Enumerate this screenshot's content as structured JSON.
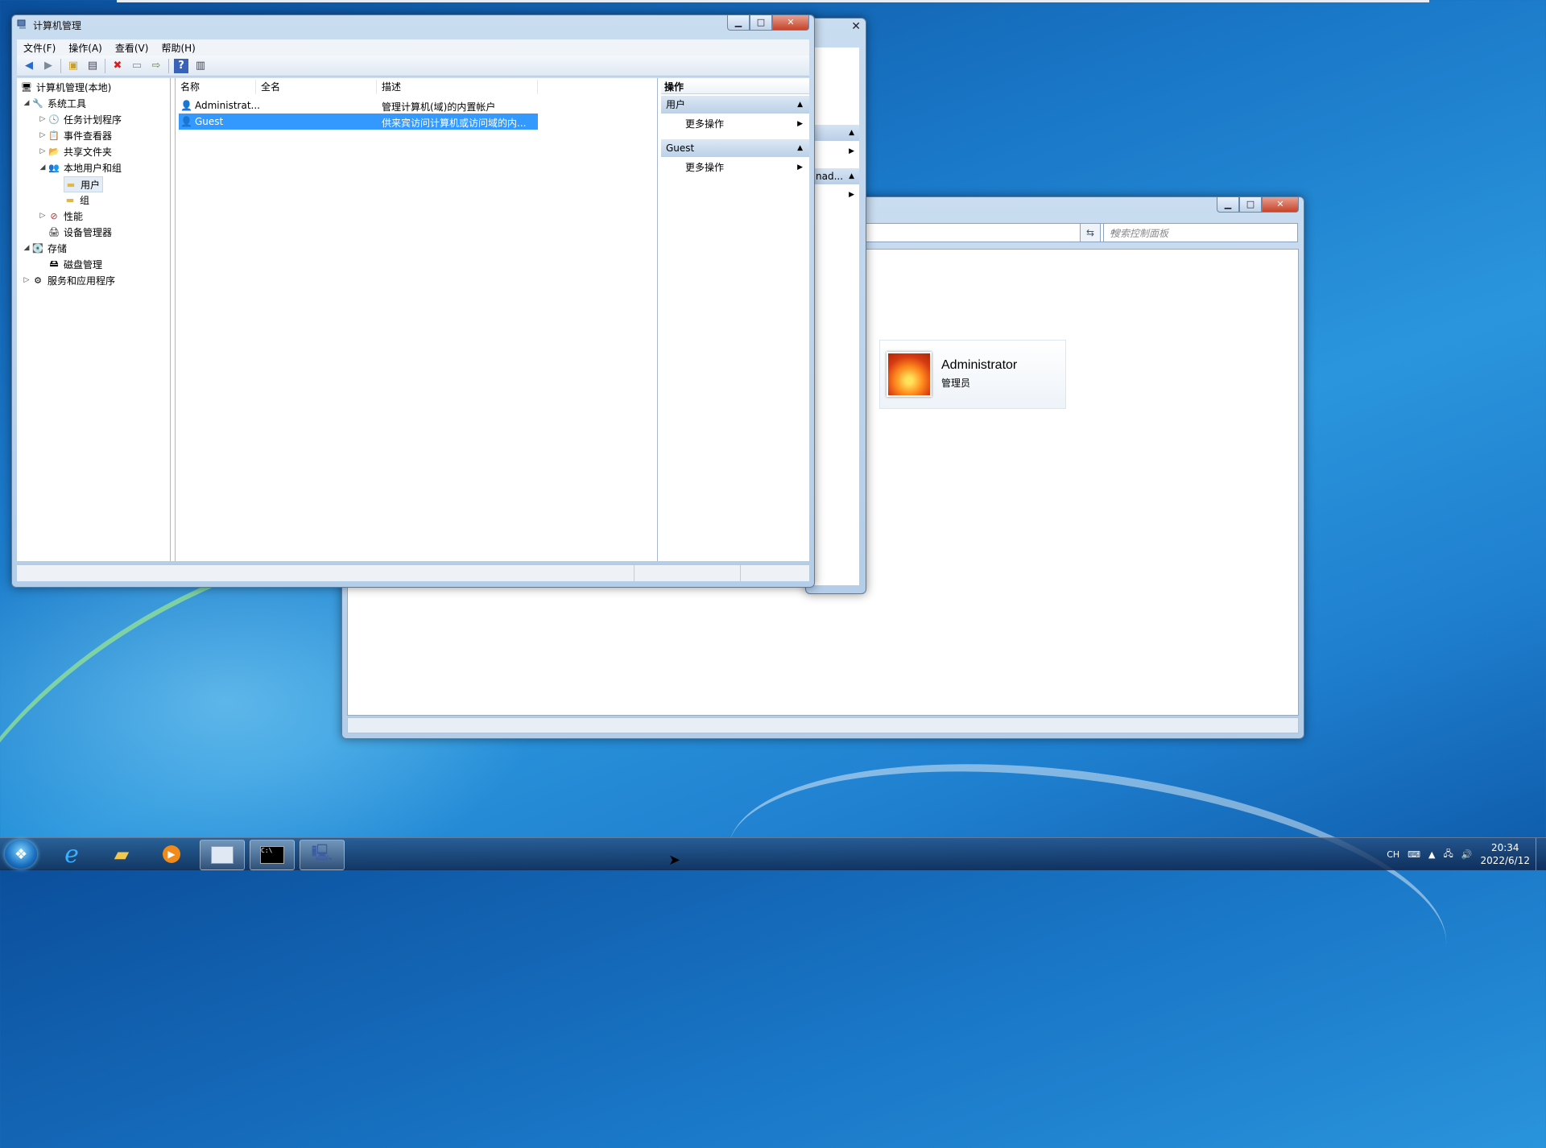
{
  "mmc": {
    "title": "计算机管理",
    "menus": [
      "文件(F)",
      "操作(A)",
      "查看(V)",
      "帮助(H)"
    ],
    "tree": [
      {
        "label": "计算机管理(本地)",
        "level": 0,
        "expander": ""
      },
      {
        "label": "系统工具",
        "level": 1,
        "expander": "◢"
      },
      {
        "label": "任务计划程序",
        "level": 2,
        "expander": "▷"
      },
      {
        "label": "事件查看器",
        "level": 2,
        "expander": "▷"
      },
      {
        "label": "共享文件夹",
        "level": 2,
        "expander": "▷"
      },
      {
        "label": "本地用户和组",
        "level": 2,
        "expander": "◢"
      },
      {
        "label": "用户",
        "level": 3,
        "expander": ""
      },
      {
        "label": "组",
        "level": 3,
        "expander": ""
      },
      {
        "label": "性能",
        "level": 2,
        "expander": "▷"
      },
      {
        "label": "设备管理器",
        "level": 2,
        "expander": ""
      },
      {
        "label": "存储",
        "level": 1,
        "expander": "◢"
      },
      {
        "label": "磁盘管理",
        "level": 2,
        "expander": ""
      },
      {
        "label": "服务和应用程序",
        "level": 1,
        "expander": "▷"
      }
    ],
    "columns": [
      "名称",
      "全名",
      "描述"
    ],
    "rows": [
      {
        "name": "Administrat...",
        "fullname": "",
        "desc": "管理计算机(域)的内置帐户"
      },
      {
        "name": "Guest",
        "fullname": "",
        "desc": "供来宾访问计算机或访问域的内..."
      }
    ],
    "actions": {
      "header": "操作",
      "sections": [
        {
          "title": "用户",
          "item": "更多操作"
        },
        {
          "title": "Guest",
          "item": "更多操作"
        }
      ]
    }
  },
  "mid": {
    "truncated": "nad..."
  },
  "cp": {
    "search_placeholder": "搜索控制面板",
    "user_name": "Administrator",
    "user_role": "管理员"
  },
  "taskbar": {
    "lang": "CH",
    "time": "20:34",
    "date": "2022/6/12"
  }
}
